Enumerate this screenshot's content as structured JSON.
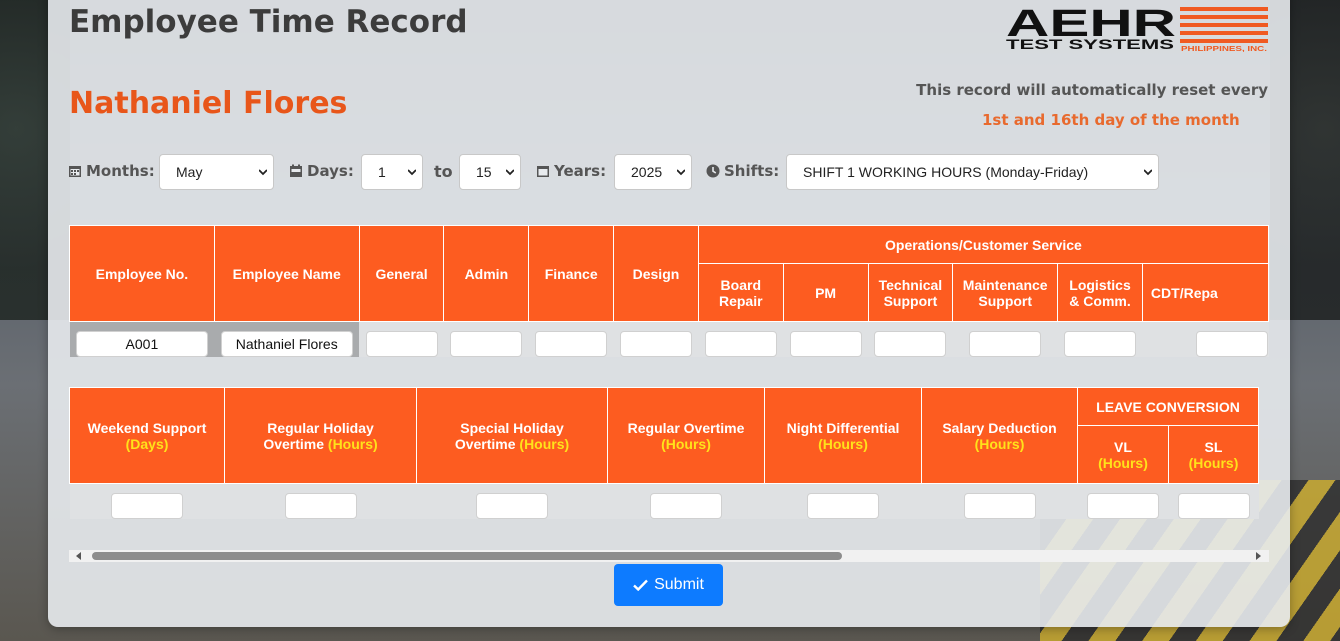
{
  "header": {
    "title": "Employee Time Record",
    "employee_name": "Nathaniel Flores",
    "logo": {
      "line1": "AEHR",
      "line2": "TEST SYSTEMS",
      "line3": "PHILIPPINES, INC."
    },
    "notice_line1": "This record will automatically reset every",
    "notice_line2": "1st and 16th day of the month"
  },
  "filters": {
    "months_label": "Months:",
    "months_value": "May",
    "days_label": "Days:",
    "day_from": "1",
    "to_label": "to",
    "day_to": "15",
    "years_label": "Years:",
    "year_value": "2025",
    "shifts_label": "Shifts:",
    "shift_value": "SHIFT 1 WORKING HOURS (Monday-Friday)"
  },
  "table1": {
    "headers": {
      "employee_no": "Employee No.",
      "employee_name": "Employee Name",
      "general": "General",
      "admin": "Admin",
      "finance": "Finance",
      "design": "Design",
      "ops_group": "Operations/Customer Service",
      "board_repair_1": "Board",
      "board_repair_2": "Repair",
      "pm": "PM",
      "tech_support_1": "Technical",
      "tech_support_2": "Support",
      "maint_support_1": "Maintenance",
      "maint_support_2": "Support",
      "logistics_1": "Logistics",
      "logistics_2": "& Comm.",
      "cdt_repair": "CDT/Repa"
    },
    "row": {
      "employee_no": "A001",
      "employee_name": "Nathaniel Flores"
    }
  },
  "table2": {
    "headers": {
      "weekend_support": "Weekend Support",
      "days_unit": "(Days)",
      "regular_holiday_1": "Regular Holiday",
      "regular_holiday_2": "Overtime",
      "special_holiday_1": "Special Holiday",
      "special_holiday_2": "Overtime",
      "regular_overtime": "Regular Overtime",
      "night_differential": "Night Differential",
      "salary_deduction": "Salary Deduction",
      "hours_unit": "(Hours)",
      "leave_conversion": "LEAVE CONVERSION",
      "vl": "VL",
      "sl": "SL"
    }
  },
  "submit_label": "Submit",
  "colors": {
    "accent": "#fd5c20",
    "highlight": "#ffe21a",
    "button": "#0d7bff",
    "name": "#e8561a"
  }
}
